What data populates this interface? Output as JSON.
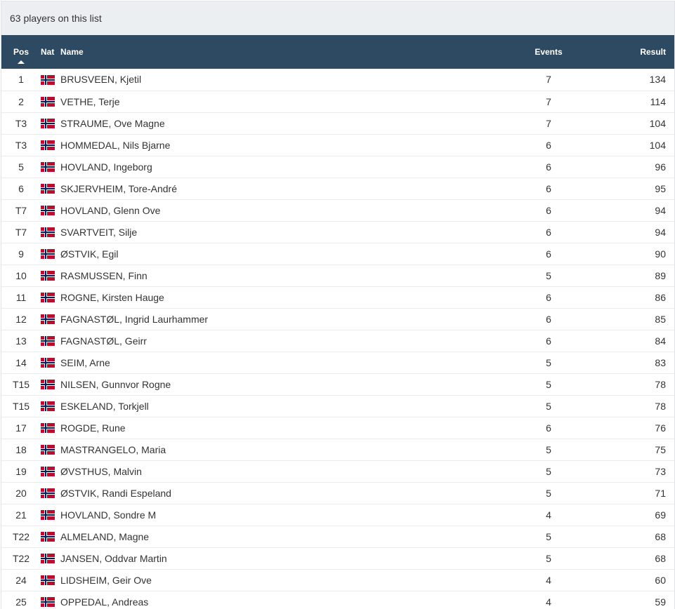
{
  "summary": "63 players on this list",
  "columns": {
    "pos": "Pos",
    "nat": "Nat",
    "name": "Name",
    "events": "Events",
    "result": "Result"
  },
  "players": [
    {
      "pos": "1",
      "nat": "norway-flag-icon",
      "name": "BRUSVEEN, Kjetil",
      "events": "7",
      "result": "134"
    },
    {
      "pos": "2",
      "nat": "norway-flag-icon",
      "name": "VETHE, Terje",
      "events": "7",
      "result": "114"
    },
    {
      "pos": "T3",
      "nat": "norway-flag-icon",
      "name": "STRAUME, Ove Magne",
      "events": "7",
      "result": "104"
    },
    {
      "pos": "T3",
      "nat": "norway-flag-icon",
      "name": "HOMMEDAL, Nils Bjarne",
      "events": "6",
      "result": "104"
    },
    {
      "pos": "5",
      "nat": "norway-flag-icon",
      "name": "HOVLAND, Ingeborg",
      "events": "6",
      "result": "96"
    },
    {
      "pos": "6",
      "nat": "norway-flag-icon",
      "name": "SKJERVHEIM, Tore-André",
      "events": "6",
      "result": "95"
    },
    {
      "pos": "T7",
      "nat": "norway-flag-icon",
      "name": "HOVLAND, Glenn Ove",
      "events": "6",
      "result": "94"
    },
    {
      "pos": "T7",
      "nat": "norway-flag-icon",
      "name": "SVARTVEIT, Silje",
      "events": "6",
      "result": "94"
    },
    {
      "pos": "9",
      "nat": "norway-flag-icon",
      "name": "ØSTVIK, Egil",
      "events": "6",
      "result": "90"
    },
    {
      "pos": "10",
      "nat": "norway-flag-icon",
      "name": "RASMUSSEN, Finn",
      "events": "5",
      "result": "89"
    },
    {
      "pos": "11",
      "nat": "norway-flag-icon",
      "name": "ROGNE, Kirsten Hauge",
      "events": "6",
      "result": "86"
    },
    {
      "pos": "12",
      "nat": "norway-flag-icon",
      "name": "FAGNASTØL, Ingrid Laurhammer",
      "events": "6",
      "result": "85"
    },
    {
      "pos": "13",
      "nat": "norway-flag-icon",
      "name": "FAGNASTØL, Geirr",
      "events": "6",
      "result": "84"
    },
    {
      "pos": "14",
      "nat": "norway-flag-icon",
      "name": "SEIM, Arne",
      "events": "5",
      "result": "83"
    },
    {
      "pos": "T15",
      "nat": "norway-flag-icon",
      "name": "NILSEN, Gunnvor Rogne",
      "events": "5",
      "result": "78"
    },
    {
      "pos": "T15",
      "nat": "norway-flag-icon",
      "name": "ESKELAND, Torkjell",
      "events": "5",
      "result": "78"
    },
    {
      "pos": "17",
      "nat": "norway-flag-icon",
      "name": "ROGDE, Rune",
      "events": "6",
      "result": "76"
    },
    {
      "pos": "18",
      "nat": "norway-flag-icon",
      "name": "MASTRANGELO, Maria",
      "events": "5",
      "result": "75"
    },
    {
      "pos": "19",
      "nat": "norway-flag-icon",
      "name": "ØVSTHUS, Malvin",
      "events": "5",
      "result": "73"
    },
    {
      "pos": "20",
      "nat": "norway-flag-icon",
      "name": "ØSTVIK, Randi Espeland",
      "events": "5",
      "result": "71"
    },
    {
      "pos": "21",
      "nat": "norway-flag-icon",
      "name": "HOVLAND, Sondre M",
      "events": "4",
      "result": "69"
    },
    {
      "pos": "T22",
      "nat": "norway-flag-icon",
      "name": "ALMELAND, Magne",
      "events": "5",
      "result": "68"
    },
    {
      "pos": "T22",
      "nat": "norway-flag-icon",
      "name": "JANSEN, Oddvar Martin",
      "events": "5",
      "result": "68"
    },
    {
      "pos": "24",
      "nat": "norway-flag-icon",
      "name": "LIDSHEIM, Geir Ove",
      "events": "4",
      "result": "60"
    },
    {
      "pos": "25",
      "nat": "norway-flag-icon",
      "name": "OPPEDAL, Andreas",
      "events": "4",
      "result": "59"
    }
  ],
  "colors": {
    "header_bg": "#2e4a62",
    "summary_bg": "#eceff2",
    "flag_red": "#ba0c2f",
    "flag_blue": "#00205b"
  }
}
